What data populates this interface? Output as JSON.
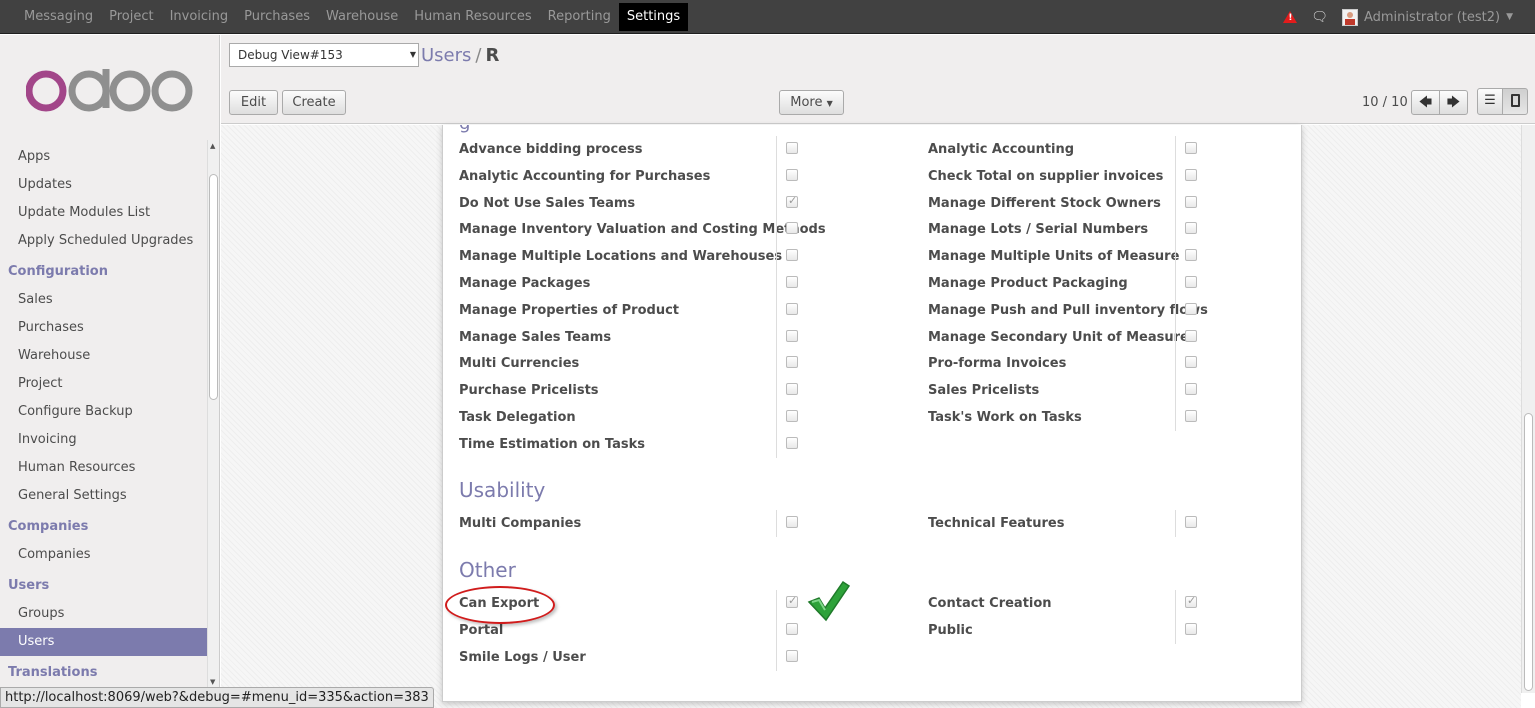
{
  "topbar": {
    "menu": [
      "Messaging",
      "Project",
      "Invoicing",
      "Purchases",
      "Warehouse",
      "Human Resources",
      "Reporting",
      "Settings"
    ],
    "active": "Settings",
    "user": "Administrator (test2)"
  },
  "sidebar": {
    "logo_text": "odoo",
    "groups": [
      {
        "heading": "",
        "items": [
          "Apps",
          "Updates",
          "Update Modules List",
          "Apply Scheduled Upgrades"
        ]
      },
      {
        "heading": "Configuration",
        "items": [
          "Sales",
          "Purchases",
          "Warehouse",
          "Project",
          "Configure Backup",
          "Invoicing",
          "Human Resources",
          "General Settings"
        ]
      },
      {
        "heading": "Companies",
        "items": [
          "Companies"
        ]
      },
      {
        "heading": "Users",
        "items": [
          "Groups",
          "Users"
        ]
      },
      {
        "heading": "Translations",
        "items": []
      }
    ],
    "active_item": "Users"
  },
  "header": {
    "debug_view": "Debug View#153",
    "breadcrumb_link": "Users",
    "breadcrumb_sep": "/",
    "breadcrumb_current": "R",
    "edit_label": "Edit",
    "create_label": "Create",
    "more_label": "More",
    "pager": "10 / 10"
  },
  "form": {
    "technical_rows": [
      {
        "left": "Advance bidding process",
        "left_checked": false,
        "right": "Analytic Accounting",
        "right_checked": false
      },
      {
        "left": "Analytic Accounting for Purchases",
        "left_checked": false,
        "right": "Check Total on supplier invoices",
        "right_checked": false
      },
      {
        "left": "Do Not Use Sales Teams",
        "left_checked": true,
        "right": "Manage Different Stock Owners",
        "right_checked": false
      },
      {
        "left": "Manage Inventory Valuation and Costing Methods",
        "left_checked": false,
        "right": "Manage Lots / Serial Numbers",
        "right_checked": false
      },
      {
        "left": "Manage Multiple Locations and Warehouses",
        "left_checked": false,
        "right": "Manage Multiple Units of Measure",
        "right_checked": false
      },
      {
        "left": "Manage Packages",
        "left_checked": false,
        "right": "Manage Product Packaging",
        "right_checked": false
      },
      {
        "left": "Manage Properties of Product",
        "left_checked": false,
        "right": "Manage Push and Pull inventory flows",
        "right_checked": false
      },
      {
        "left": "Manage Sales Teams",
        "left_checked": false,
        "right": "Manage Secondary Unit of Measure",
        "right_checked": false
      },
      {
        "left": "Multi Currencies",
        "left_checked": false,
        "right": "Pro-forma Invoices",
        "right_checked": false
      },
      {
        "left": "Purchase Pricelists",
        "left_checked": false,
        "right": "Sales Pricelists",
        "right_checked": false
      },
      {
        "left": "Task Delegation",
        "left_checked": false,
        "right": "Task's Work on Tasks",
        "right_checked": false
      },
      {
        "left": "Time Estimation on Tasks",
        "left_checked": false,
        "right": "",
        "right_checked": null
      }
    ],
    "usability_title": "Usability",
    "usability_rows": [
      {
        "left": "Multi Companies",
        "left_checked": false,
        "right": "Technical Features",
        "right_checked": false
      }
    ],
    "other_title": "Other",
    "other_rows": [
      {
        "left": "Can Export",
        "left_checked": true,
        "right": "Contact Creation",
        "right_checked": true
      },
      {
        "left": "Portal",
        "left_checked": false,
        "right": "Public",
        "right_checked": false
      },
      {
        "left": "Smile Logs / User",
        "left_checked": false,
        "right": "",
        "right_checked": null
      }
    ]
  },
  "statusbar": {
    "url": "http://localhost:8069/web?&debug=#menu_id=335&action=383"
  },
  "colors": {
    "accent": "#7c7bad",
    "topbar": "#414141",
    "annotation_red": "#d01c1c",
    "annotation_green": "#2ea23a"
  }
}
